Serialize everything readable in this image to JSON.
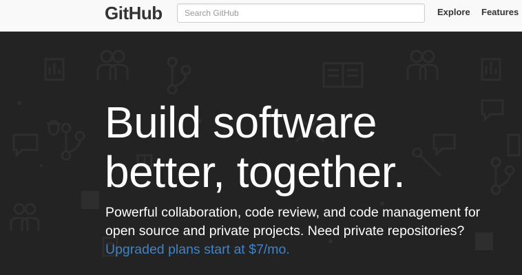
{
  "header": {
    "logo": "GitHub",
    "search_placeholder": "Search GitHub",
    "nav": [
      "Explore",
      "Features"
    ]
  },
  "hero": {
    "headline_line1": "Build software",
    "headline_line2": "better, together.",
    "subtext_line1": "Powerful collaboration, code review, and code management for",
    "subtext_line2": "open source and private projects. Need private repositories?",
    "plans_link": "Upgraded plans start at $7/mo."
  },
  "colors": {
    "header_bg": "#f9f9f9",
    "hero_bg": "#232323",
    "link": "#4183c4",
    "logo_text": "#333333"
  }
}
